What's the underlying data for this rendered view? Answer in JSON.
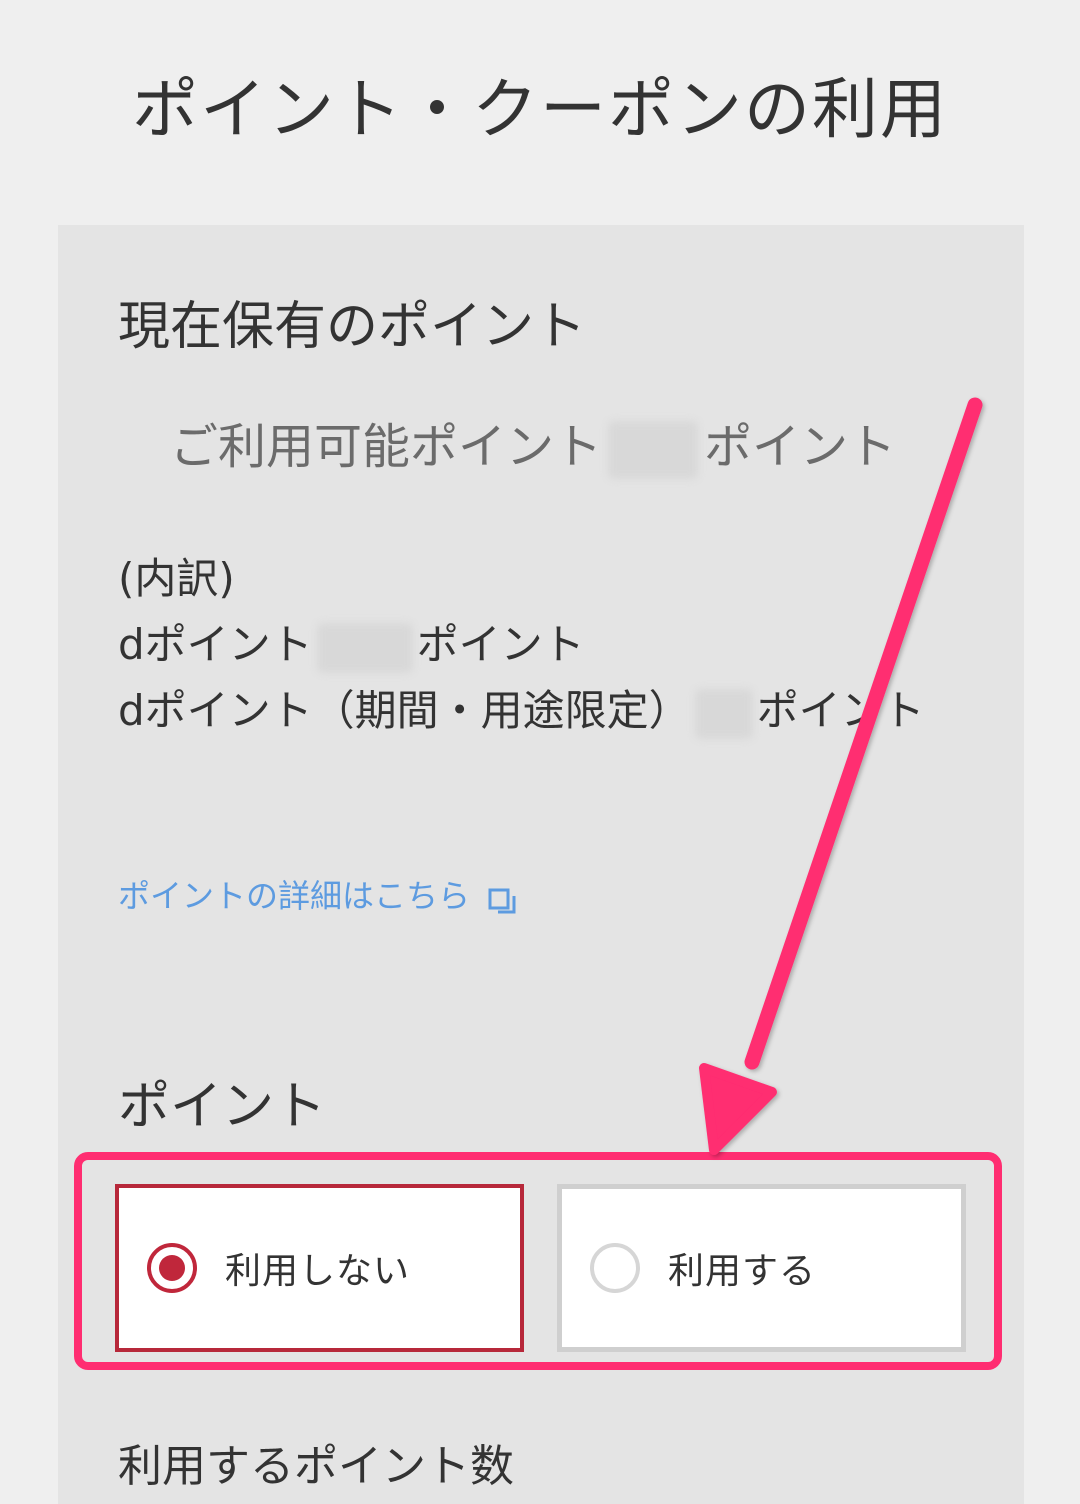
{
  "page": {
    "title": "ポイント・クーポンの利用"
  },
  "held_points": {
    "heading": "現在保有のポイント",
    "available_label": "ご利用可能ポイント",
    "available_suffix": "ポイント",
    "available_value": "",
    "breakdown_label": "(内訳)",
    "dpoint_label": "dポイント",
    "dpoint_suffix": "ポイント",
    "dpoint_value": "",
    "dpoint_limited_label": "dポイント（期間・用途限定）",
    "dpoint_limited_suffix": "ポイント",
    "dpoint_limited_value": "",
    "detail_link": "ポイントの詳細はこちら"
  },
  "point_use": {
    "heading": "ポイント",
    "options": [
      {
        "label": "利用しない",
        "selected": true
      },
      {
        "label": "利用する",
        "selected": false
      }
    ],
    "use_count_heading": "利用するポイント数"
  },
  "colors": {
    "accent_red": "#c0273b",
    "annotation_pink": "#ff2d71",
    "link_blue": "#5d9be0"
  },
  "icons": {
    "detail_link": "external-link-icon"
  }
}
